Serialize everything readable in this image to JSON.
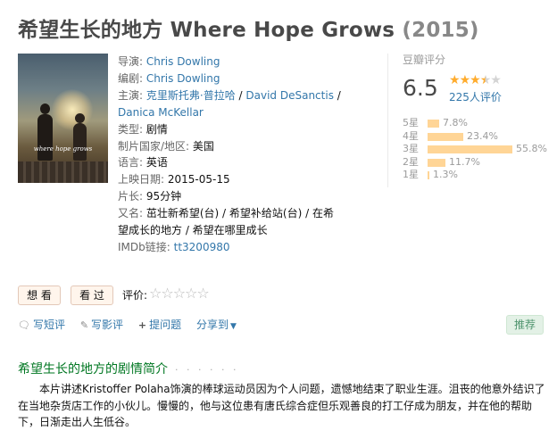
{
  "header": {
    "title": "希望生长的地方 Where Hope Grows",
    "year": "(2015)"
  },
  "poster": {
    "caption": "where hope grows"
  },
  "info": {
    "director_label": "导演:",
    "director": "Chris Dowling",
    "writer_label": "编剧:",
    "writer": "Chris Dowling",
    "cast_label": "主演:",
    "cast": [
      "克里斯托弗·普拉哈",
      "David DeSanctis",
      "Danica McKellar"
    ],
    "cast_sep": " / ",
    "genre_label": "类型:",
    "genre": "剧情",
    "country_label": "制片国家/地区:",
    "country": "美国",
    "language_label": "语言:",
    "language": "英语",
    "release_label": "上映日期:",
    "release": "2015-05-15",
    "runtime_label": "片长:",
    "runtime": "95分钟",
    "aka_label": "又名:",
    "aka": "茁壮新希望(台) / 希望补给站(台) / 在希望成长的地方 / 希望在哪里成长",
    "imdb_label": "IMDb链接:",
    "imdb": "tt3200980"
  },
  "rating": {
    "label": "豆瓣评分",
    "score": "6.5",
    "stars_value": 3.5,
    "votes": "225人评价",
    "distribution": [
      {
        "label": "5星",
        "percent": 7.8,
        "text": "7.8%"
      },
      {
        "label": "4星",
        "percent": 23.4,
        "text": "23.4%"
      },
      {
        "label": "3星",
        "percent": 55.8,
        "text": "55.8%"
      },
      {
        "label": "2星",
        "percent": 11.7,
        "text": "11.7%"
      },
      {
        "label": "1星",
        "percent": 1.3,
        "text": "1.3%"
      }
    ]
  },
  "actions": {
    "want": "想 看",
    "seen": "看 过",
    "rate_label": "评价:",
    "write_review_short": "写短评",
    "write_review": "写影评",
    "ask": "提问题",
    "share": "分享到",
    "recommend": "推荐"
  },
  "synopsis": {
    "title": "希望生长的地方的剧情简介",
    "dots": "· · · · · ·",
    "text": "本片讲述Kristoffer Polaha饰演的棒球运动员因为个人问题，遗憾地结束了职业生涯。沮丧的他意外结识了在当地杂货店工作的小伙儿。慢慢的，他与这位患有唐氏综合症但乐观善良的打工仔成为朋友，并在他的帮助下，日渐走出人生低谷。"
  },
  "colors": {
    "link": "#3377aa",
    "green": "#007722",
    "star": "#ffac2d",
    "bar": "#ffd596"
  }
}
